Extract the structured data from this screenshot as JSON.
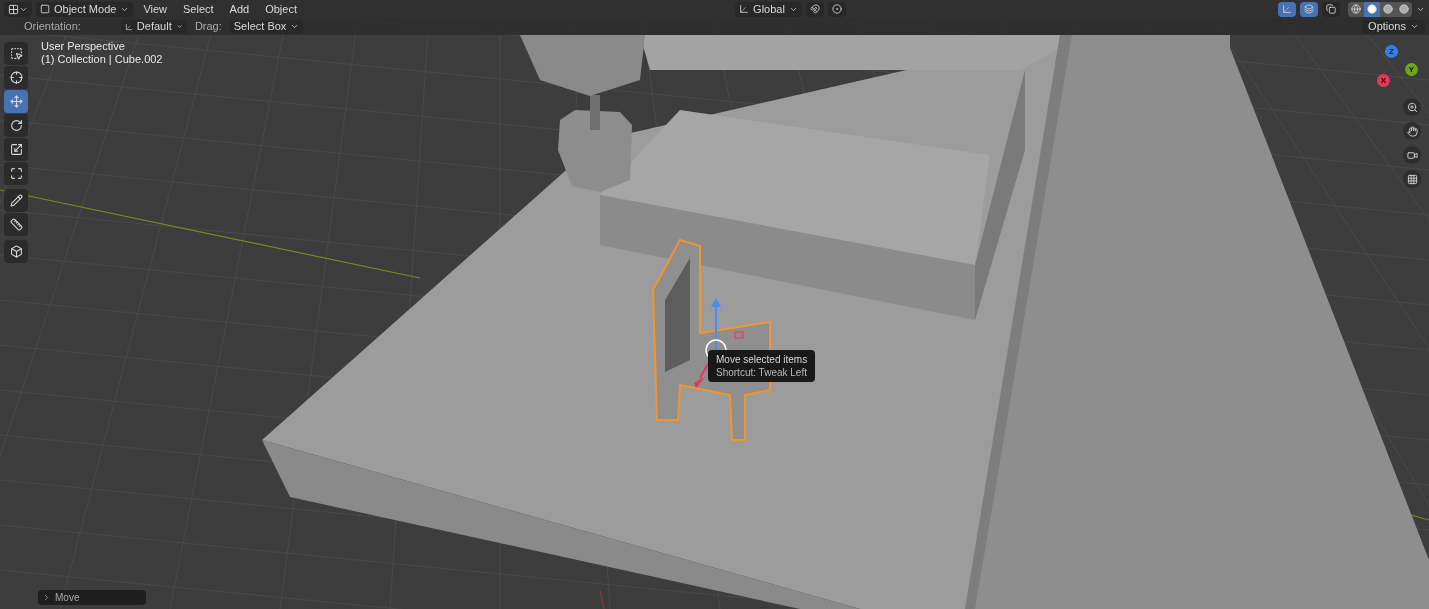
{
  "header": {
    "mode": "Object Mode",
    "menus": [
      "View",
      "Select",
      "Add",
      "Object"
    ],
    "transform_orientation": "Global",
    "toggles": [
      {
        "kind": "snap",
        "on": false
      },
      {
        "kind": "proportional",
        "on": false
      },
      {
        "kind": "gizmos",
        "on": true
      },
      {
        "kind": "overlays",
        "on": true
      },
      {
        "kind": "xray",
        "on": false
      }
    ],
    "shading": [
      {
        "kind": "wireframe",
        "selected": false
      },
      {
        "kind": "solid",
        "selected": true
      },
      {
        "kind": "material",
        "selected": false
      },
      {
        "kind": "rendered",
        "selected": false
      }
    ]
  },
  "tool_settings": {
    "orientation_label": "Orientation:",
    "orientation": "Default",
    "drag_label": "Drag:",
    "drag": "Select Box"
  },
  "viewport": {
    "view_name": "User Perspective",
    "object_info": "(1) Collection | Cube.002",
    "options": "Options"
  },
  "toolbar": [
    {
      "kind": "select",
      "selected": false
    },
    {
      "kind": "cursor",
      "selected": false
    },
    {
      "kind": "move",
      "selected": true
    },
    {
      "kind": "rotate",
      "selected": false
    },
    {
      "kind": "scale",
      "selected": false
    },
    {
      "kind": "transform",
      "selected": false
    },
    {
      "kind": "annotate",
      "selected": false
    },
    {
      "kind": "measure",
      "selected": false
    },
    {
      "kind": "add_cube",
      "selected": false
    }
  ],
  "gizmo_axes": [
    {
      "label": "Z",
      "color": "#2f83e8"
    },
    {
      "label": "Y",
      "color": "#6fa31c"
    },
    {
      "label": "X",
      "color": "#e8365a"
    }
  ],
  "tooltip": {
    "title": "Move selected items",
    "shortcut": "Shortcut: Tweak Left"
  },
  "operator_panel": {
    "title": "Move",
    "expanded": false
  }
}
